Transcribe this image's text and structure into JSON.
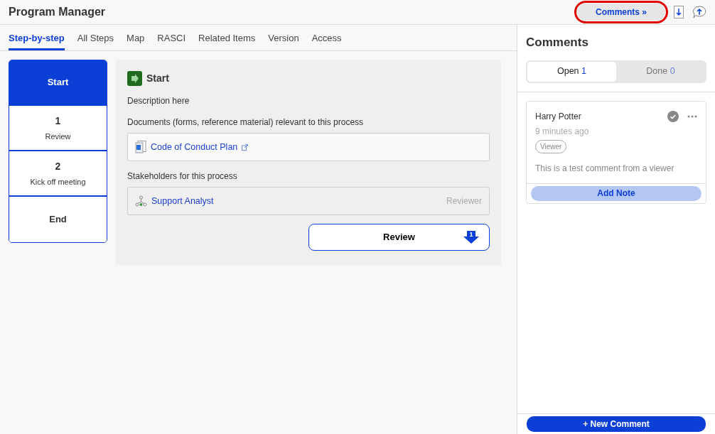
{
  "header": {
    "title": "Program Manager",
    "comments_button": {
      "label": "Comments",
      "chevron": "»",
      "highlighted": true
    }
  },
  "tabs": [
    {
      "label": "Step-by-step",
      "selected": true
    },
    {
      "label": "All Steps",
      "selected": false
    },
    {
      "label": "Map",
      "selected": false
    },
    {
      "label": "RASCI",
      "selected": false
    },
    {
      "label": "Related Items",
      "selected": false
    },
    {
      "label": "Version",
      "selected": false
    },
    {
      "label": "Access",
      "selected": false
    }
  ],
  "steps": [
    {
      "label": "Start",
      "selected": true
    },
    {
      "number": "1",
      "label": "Review",
      "selected": false
    },
    {
      "number": "2",
      "label": "Kick off meeting",
      "selected": false
    },
    {
      "label": "End",
      "selected": false
    }
  ],
  "detail": {
    "title": "Start",
    "description": "Description here",
    "documents_label": "Documents (forms, reference material) relevant to this process",
    "documents": [
      {
        "name": "Code of Conduct Plan"
      }
    ],
    "stakeholders_label": "Stakeholders for this process",
    "stakeholders": [
      {
        "name": "Support Analyst",
        "role": "Reviewer"
      }
    ],
    "next_button": {
      "label": "Review",
      "badge": "1"
    }
  },
  "comments": {
    "title": "Comments",
    "filters": [
      {
        "label": "Open",
        "count": "1",
        "selected": true
      },
      {
        "label": "Done",
        "count": "0",
        "selected": false
      }
    ],
    "items": [
      {
        "author": "Harry Potter",
        "time": "9 minutes ago",
        "role": "Viewer",
        "text": "This is a test comment from a viewer",
        "resolved": true,
        "action": "Add Note"
      }
    ],
    "new_button": "+ New Comment"
  }
}
